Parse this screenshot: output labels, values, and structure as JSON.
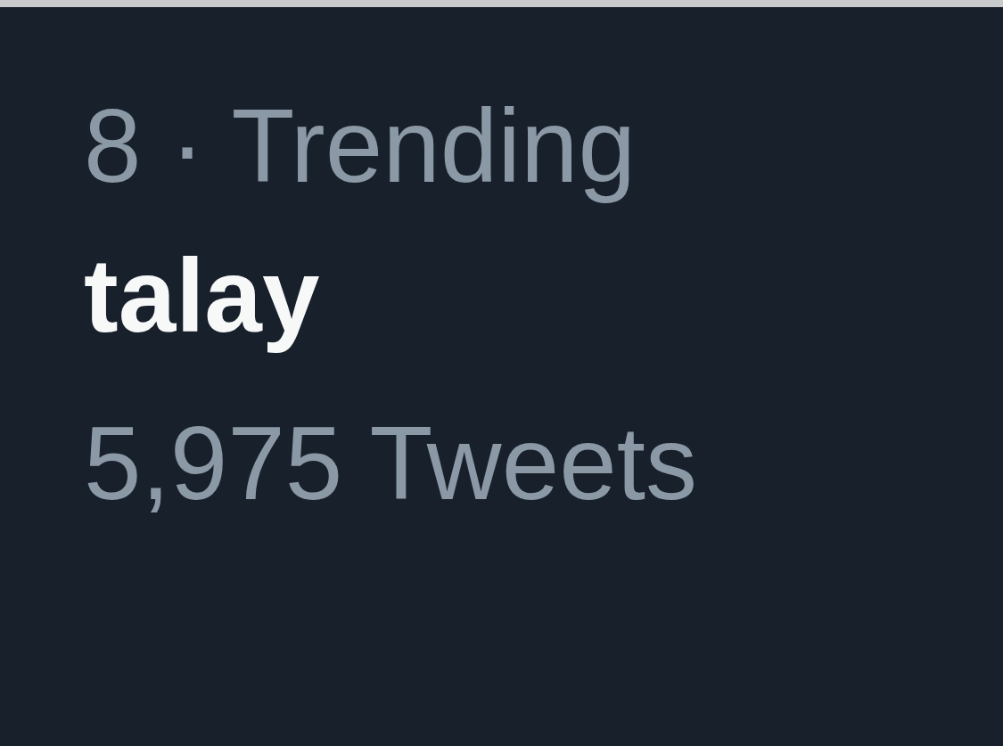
{
  "trend": {
    "context": "8 · Trending",
    "title": "talay",
    "count": "5,975 Tweets"
  }
}
